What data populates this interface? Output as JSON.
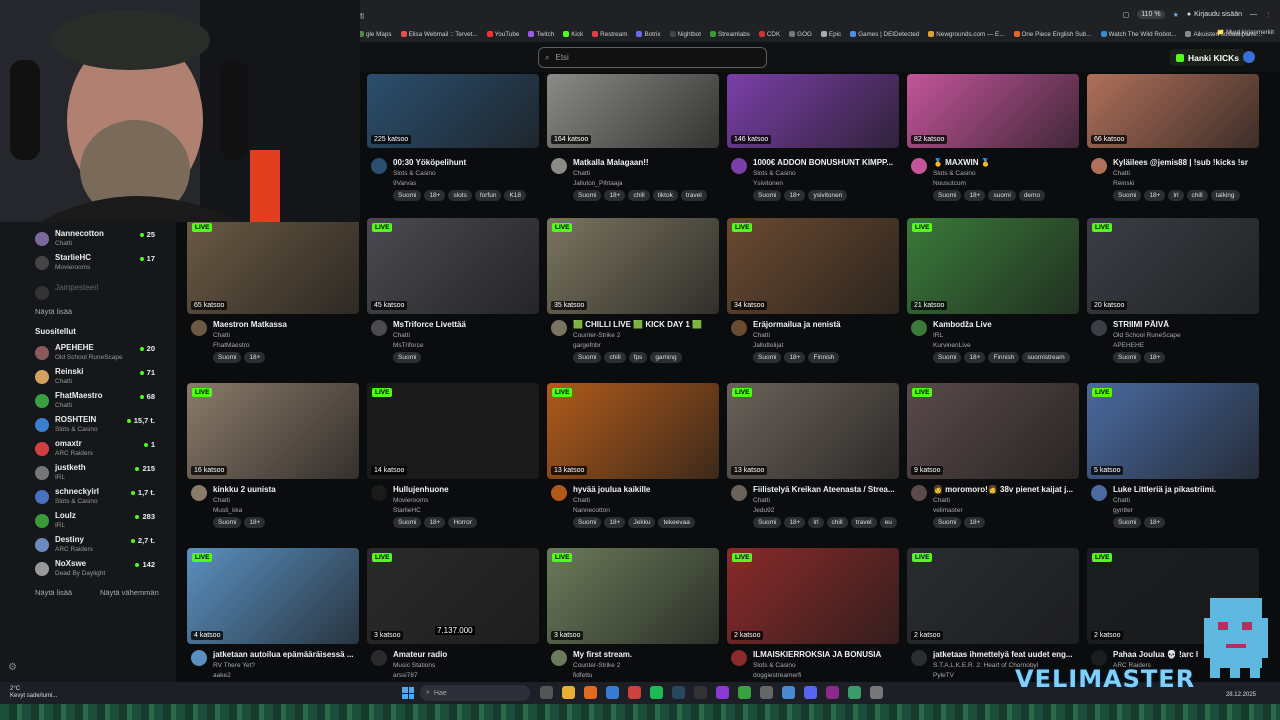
{
  "browser": {
    "address_fragment": "fi",
    "zoom": "110 %",
    "login": "Kirjaudu sisään",
    "bookmarks": [
      "gle Maps",
      "Elisa Webmail :: Tervet...",
      "YouTube",
      "Twitch",
      "Kick",
      "Restream",
      "Botrix",
      "Nightbot",
      "Streamlabs",
      "CDK",
      "GOG",
      "Epic",
      "Games | DEIDetected",
      "Newgrounds.com — E...",
      "One Piece English Sub...",
      "Watch The Wild Robot...",
      "Aikuisten sosiaalipalve..."
    ],
    "bookmarks_other": "Muut kirjanmerkit"
  },
  "header": {
    "search_placeholder": "Etsi",
    "hanki": "Hanki KICKs"
  },
  "sidebar": {
    "followed": [
      {
        "name": "Nannecotton",
        "category": "Chatti",
        "viewers": "25",
        "color": "#7a6a9a"
      },
      {
        "name": "StarlieHC",
        "category": "Movierooms",
        "viewers": "17",
        "color": "#444"
      }
    ],
    "offline": {
      "name": "Jampesteeri"
    },
    "show_more_1": "Näytä lisää",
    "recommended_title": "Suositellut",
    "recommended": [
      {
        "name": "APEHEHE",
        "category": "Old School RuneScape",
        "viewers": "20",
        "color": "#8a5a5a"
      },
      {
        "name": "Reinski",
        "category": "Chatti",
        "viewers": "71",
        "color": "#d4a060"
      },
      {
        "name": "FhatMaestro",
        "category": "Chatti",
        "viewers": "68",
        "color": "#3aa040"
      },
      {
        "name": "ROSHTEIN",
        "category": "Slots & Casino",
        "viewers": "15,7 t.",
        "color": "#3a7fd0"
      },
      {
        "name": "omaxtr",
        "category": "ARC Raiders",
        "viewers": "1",
        "color": "#d04040"
      },
      {
        "name": "justketh",
        "category": "IRL",
        "viewers": "215",
        "color": "#777"
      },
      {
        "name": "schneckyirl",
        "category": "Slots & Casino",
        "viewers": "1,7 t.",
        "color": "#4a70c0"
      },
      {
        "name": "Loulz",
        "category": "IRL",
        "viewers": "283",
        "color": "#3a9a3a"
      },
      {
        "name": "Destiny",
        "category": "ARC Raiders",
        "viewers": "2,7 t.",
        "color": "#6a8ac0"
      },
      {
        "name": "NoXswe",
        "category": "Dead By Daylight",
        "viewers": "142",
        "color": "#999"
      }
    ],
    "show_more_2": "Näytä lisää",
    "show_less": "Näytä vähemmän"
  },
  "rows": [
    [
      {
        "views": "225 katsoo",
        "title": "00:30 Yököpelihunt",
        "category": "Slots & Casino",
        "streamer": "9Varvas",
        "tags": [
          "Suomi",
          "18+",
          "slots",
          "forfun",
          "K18"
        ],
        "bg": "#2b4f6e",
        "live": false
      },
      {
        "views": "164 katsoo",
        "title": "Matkalla Malagaan!!",
        "category": "Chatti",
        "streamer": "Jalluton_Pihtaaja",
        "tags": [
          "Suomi",
          "18+",
          "chill",
          "tiktok",
          "travel"
        ],
        "bg": "#8a8a86",
        "live": false
      },
      {
        "views": "146 katsoo",
        "title": "1000€ ADDON BONUSHUNT KIMPP...",
        "category": "Slots & Casino",
        "streamer": "Ysivitonen",
        "tags": [
          "Suomi",
          "18+",
          "ysivitonen"
        ],
        "bg": "#7a3fa8",
        "live": false
      },
      {
        "views": "82 katsoo",
        "title": "🥇 MAXWIN 🥇",
        "category": "Slots & Casino",
        "streamer": "Nousutcom",
        "tags": [
          "Suomi",
          "18+",
          "suomi",
          "demo"
        ],
        "bg": "#c4559a",
        "live": false
      },
      {
        "views": "66 katsoo",
        "title": "Kyläilees @jemis88 | !sub !kicks !sr",
        "category": "Chatti",
        "streamer": "Reinski",
        "tags": [
          "Suomi",
          "18+",
          "lrl",
          "chill",
          "talking"
        ],
        "bg": "#b0705a",
        "live": false
      }
    ],
    [
      {
        "views": "65 katsoo",
        "title": "Maestron Matkassa",
        "category": "Chatti",
        "streamer": "FhatMaestro",
        "tags": [
          "Suomi",
          "18+"
        ],
        "bg": "#6a5a44",
        "live": true
      },
      {
        "views": "45 katsoo",
        "title": "MsTriforce Livettää",
        "category": "Chatti",
        "streamer": "MsTriforce",
        "tags": [
          "Suomi"
        ],
        "bg": "#4a4a50",
        "live": true
      },
      {
        "views": "35 katsoo",
        "title": "🟩 CHILLI LIVE 🟩 KICK DAY 1 🟩",
        "category": "Counter-Strike 2",
        "streamer": "gargefnbr",
        "tags": [
          "Suomi",
          "chill",
          "fps",
          "gaming"
        ],
        "bg": "#7a7560",
        "live": true
      },
      {
        "views": "34 katsoo",
        "title": "Eräjormailua ja nenistä",
        "category": "Chatti",
        "streamer": "Jalluttelijat",
        "tags": [
          "Suomi",
          "18+",
          "Finnish"
        ],
        "bg": "#6a4a30",
        "live": true
      },
      {
        "views": "21 katsoo",
        "title": "Kambodža Live",
        "category": "IRL",
        "streamer": "KurvinenLive",
        "tags": [
          "Suomi",
          "18+",
          "Finnish",
          "suomistream"
        ],
        "bg": "#3a7a3a",
        "live": true
      },
      {
        "views": "20 katsoo",
        "title": "STRIIMI PÄIVÄ",
        "category": "Old School RuneScape",
        "streamer": "APEHEHE",
        "tags": [
          "Suomi",
          "18+"
        ],
        "bg": "#3a3e44",
        "live": true
      }
    ],
    [
      {
        "views": "16 katsoo",
        "title": "kinkku 2 uunista",
        "category": "Chatti",
        "streamer": "Musti_kka",
        "tags": [
          "Suomi",
          "18+"
        ],
        "bg": "#8a7a6a",
        "live": true
      },
      {
        "views": "14 katsoo",
        "title": "Hullujenhuone",
        "category": "Movierooms",
        "streamer": "StarlieHC",
        "tags": [
          "Suomi",
          "18+",
          "Horror"
        ],
        "bg": "#1a1a1a",
        "live": true
      },
      {
        "views": "13 katsoo",
        "title": "hyvää joulua kaikille",
        "category": "Chatti",
        "streamer": "Nannecotton",
        "tags": [
          "Suomi",
          "18+",
          "Jekku",
          "tekeevaa"
        ],
        "bg": "#b05a1a",
        "live": true
      },
      {
        "views": "13 katsoo",
        "title": "Fiilistelyä Kreikan Ateenasta / Strea...",
        "category": "Chatti",
        "streamer": "Jedu92",
        "tags": [
          "Suomi",
          "18+",
          "lrl",
          "chill",
          "travel",
          "eu"
        ],
        "bg": "#6a625a",
        "live": true
      },
      {
        "views": "9 katsoo",
        "title": "👩 moromoro!👩 38v pienet kaijat j...",
        "category": "Chatti",
        "streamer": "velimaster",
        "tags": [
          "Suomi",
          "18+"
        ],
        "bg": "#5a4a4a",
        "live": true
      },
      {
        "views": "5 katsoo",
        "title": "Luke Littleriä ja pikastriimi.",
        "category": "Chatti",
        "streamer": "gyntter",
        "tags": [
          "Suomi",
          "18+"
        ],
        "bg": "#4a6aa0",
        "live": true
      }
    ],
    [
      {
        "views": "4 katsoo",
        "title": "jatketaan autoilua epämääräisessä ...",
        "category": "RV There Yet?",
        "streamer": "aake2",
        "tags": [],
        "bg": "#5a90c0",
        "live": true
      },
      {
        "views": "3 katsoo",
        "title": "Amateur radio",
        "category": "Music Stations",
        "streamer": "arssi787",
        "tags": [],
        "bg": "#2a2a2a",
        "live": true
      },
      {
        "views": "3 katsoo",
        "title": "My first stream.",
        "category": "Counter-Strike 2",
        "streamer": "fidfettu",
        "tags": [],
        "bg": "#6a7a5a",
        "live": true
      },
      {
        "views": "2 katsoo",
        "title": "ILMAISKIERROKSIA JA BONUSIA",
        "category": "Slots & Casino",
        "streamer": "doggiestreamerfi",
        "tags": [],
        "bg": "#8a2a2a",
        "live": true
      },
      {
        "views": "2 katsoo",
        "title": "jatketaas ihmettelyä feat uudet eng...",
        "category": "S.T.A.L.K.E.R. 2: Heart of Chornobyl",
        "streamer": "PyleTV",
        "tags": [],
        "bg": "#2a2c30",
        "live": true
      },
      {
        "views": "2 katsoo",
        "title": "Pahaa Joulua 💀 !arc l",
        "category": "ARC Raiders",
        "streamer": "",
        "tags": [],
        "bg": "#1a1c1e",
        "live": true
      }
    ]
  ],
  "amateur_radio_freq": "7.137.000",
  "taskbar": {
    "temp": "2°C",
    "weather": "Kevyt sade/lumi...",
    "search": "Hae",
    "date": "28.12.2025"
  },
  "overlay_text": "VELIMASTER"
}
